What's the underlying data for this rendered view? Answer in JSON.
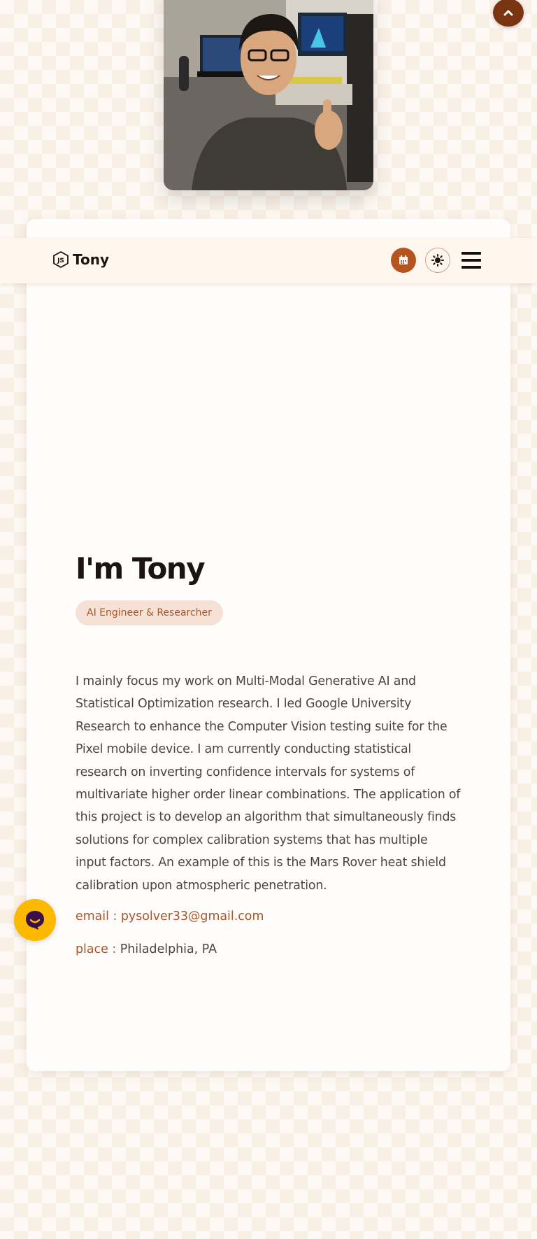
{
  "profile_photo": {
    "icon": "profile-photo"
  },
  "scroll_top": {
    "icon": "chevron-up-icon"
  },
  "navbar": {
    "brand": {
      "icon": "js-hexagon-icon",
      "name": "Tony"
    },
    "calendar_icon": "calendar-icon",
    "theme_icon": "sun-icon",
    "menu_icon": "hamburger-menu-icon"
  },
  "hero": {
    "title": "I'm Tony",
    "badge": "AI Engineer & Researcher",
    "bio": "I mainly focus my work on Multi-Modal Generative AI and Statistical Optimization research. I led Google University Research to enhance the Computer Vision testing suite for the Pixel mobile device. I am currently conducting statistical research on inverting confidence intervals for systems of multivariate higher order linear combinations. The application of this project is to develop an algorithm that simultaneously finds solutions for complex calibration systems that has multiple input factors. An example of this is the Mars Rover heat shield calibration upon atmospheric penetration.",
    "email_label": "email : ",
    "email": "pysolver33@gmail.com",
    "place_label": "place : ",
    "place": "Philadelphia, PA"
  },
  "chat_widget": {
    "icon": "chat-bubble-icon"
  },
  "colors": {
    "accent": "#b5541f",
    "dark_accent": "#7b3411",
    "badge_bg": "#f5e1d6",
    "chat": "#fcb900"
  }
}
